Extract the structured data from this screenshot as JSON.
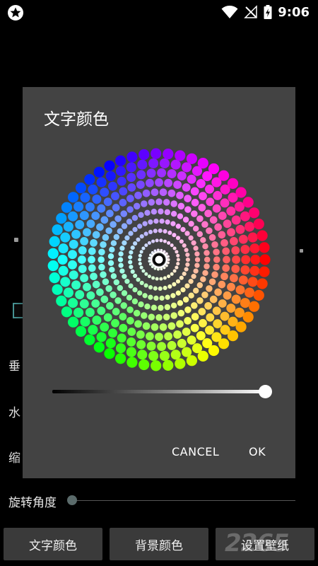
{
  "status": {
    "time": "9:06",
    "icons": [
      "star-icon",
      "wifi-icon",
      "signal-off-icon",
      "battery-charging-icon"
    ]
  },
  "background": {
    "labels": [
      "垂",
      "水",
      "缩"
    ],
    "rotate_label": "旋转角度",
    "rotate_value": 0,
    "buttons": [
      "文字颜色",
      "背景颜色",
      "设置壁纸"
    ]
  },
  "dialog": {
    "title": "文字颜色",
    "brightness": 1.0,
    "cancel_label": "CANCEL",
    "ok_label": "OK",
    "selected_color": "#ffffff"
  },
  "colors": {
    "dialog_bg": "#434343",
    "button_bg": "#3a3a3a"
  }
}
